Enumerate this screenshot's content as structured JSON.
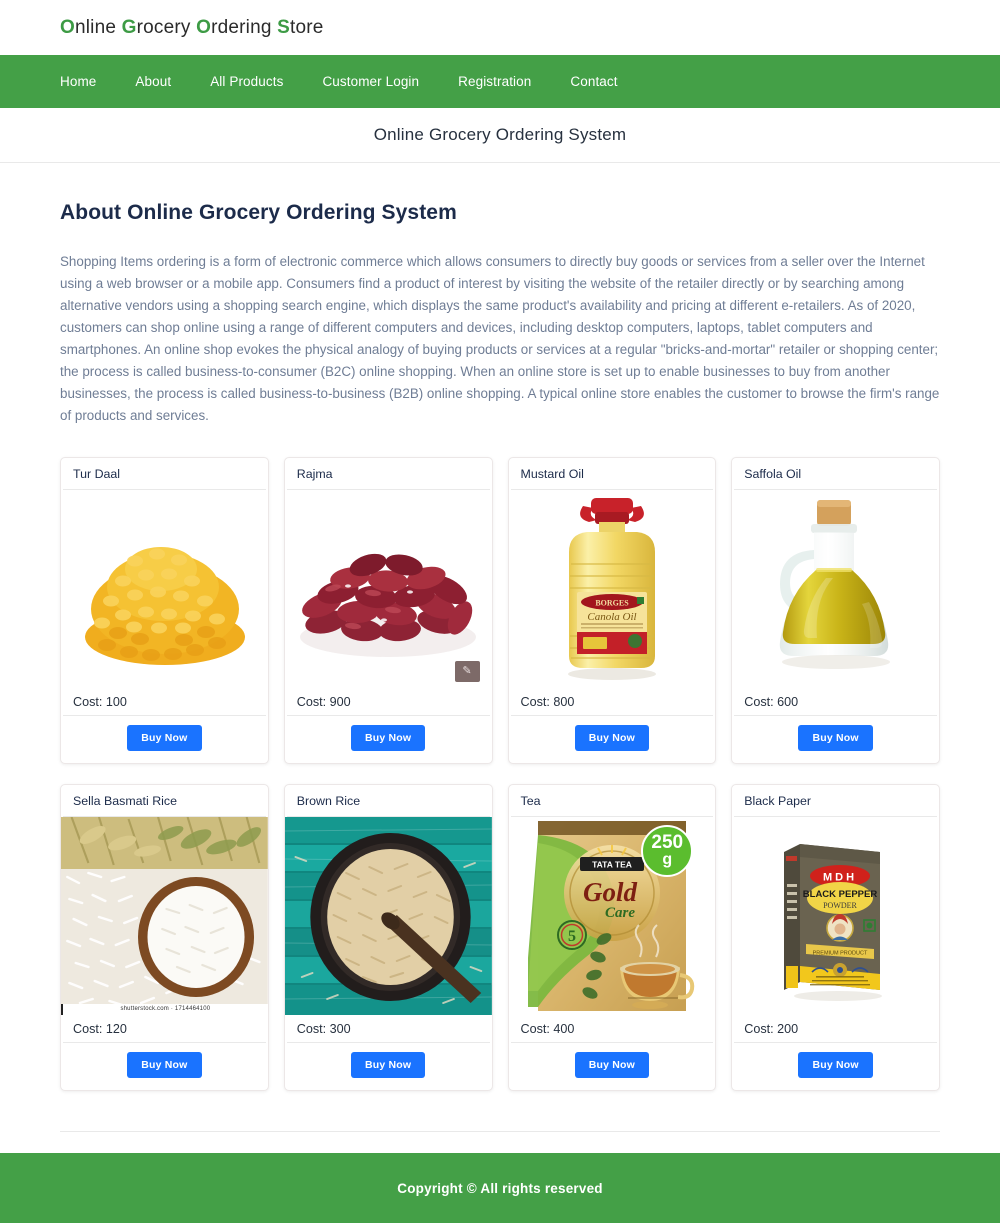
{
  "site": {
    "logo_parts": [
      {
        "cap": "O",
        "rest": "nline"
      },
      {
        "cap": "G",
        "rest": "rocery"
      },
      {
        "cap": "O",
        "rest": "rdering"
      },
      {
        "cap": "S",
        "rest": "tore"
      }
    ],
    "logo_full": "Online Grocery Ordering Store",
    "brand_green": "#44a047",
    "accent_blue": "#1a73ff"
  },
  "nav": {
    "items": [
      {
        "label": "Home"
      },
      {
        "label": "About"
      },
      {
        "label": "All Products"
      },
      {
        "label": "Customer Login"
      },
      {
        "label": "Registration"
      },
      {
        "label": "Contact"
      }
    ]
  },
  "page": {
    "title": "Online Grocery Ordering System",
    "about_heading": "About Online Grocery Ordering System",
    "about_body": "Shopping Items ordering is a form of electronic commerce which allows consumers to directly buy goods or services from a seller over the Internet using a web browser or a mobile app. Consumers find a product of interest by visiting the website of the retailer directly or by searching among alternative vendors using a shopping search engine, which displays the same product's availability and pricing at different e-retailers. As of 2020, customers can shop online using a range of different computers and devices, including desktop computers, laptops, tablet computers and smartphones. An online shop evokes the physical analogy of buying products or services at a regular \"bricks-and-mortar\" retailer or shopping center; the process is called business-to-consumer (B2C) online shopping. When an online store is set up to enable businesses to buy from another businesses, the process is called business-to-business (B2B) online shopping. A typical online store enables the customer to browse the firm's range of products and services."
  },
  "products": [
    {
      "name": "Tur Daal",
      "cost_label": "Cost: 100",
      "cost": 100,
      "buy_label": "Buy Now",
      "art": "tur-daal"
    },
    {
      "name": "Rajma",
      "cost_label": "Cost: 900",
      "cost": 900,
      "buy_label": "Buy Now",
      "art": "rajma",
      "watermark": "✎"
    },
    {
      "name": "Mustard Oil",
      "cost_label": "Cost: 800",
      "cost": 800,
      "buy_label": "Buy Now",
      "art": "mustard-oil",
      "pack_brand": "BORGES",
      "pack_title": "Canola Oil"
    },
    {
      "name": "Saffola Oil",
      "cost_label": "Cost: 600",
      "cost": 600,
      "buy_label": "Buy Now",
      "art": "saffola-oil"
    },
    {
      "name": "Sella Basmati Rice",
      "cost_label": "Cost: 120",
      "cost": 120,
      "buy_label": "Buy Now",
      "art": "sella-basmati-rice",
      "credit": "shutterstock.com · 1714464100"
    },
    {
      "name": "Brown Rice",
      "cost_label": "Cost: 300",
      "cost": 300,
      "buy_label": "Buy Now",
      "art": "brown-rice"
    },
    {
      "name": "Tea",
      "cost_label": "Cost: 400",
      "cost": 400,
      "buy_label": "Buy Now",
      "art": "tea",
      "badge_top": "250",
      "badge_bottom": "g",
      "pack_brand": "TATA TEA",
      "pack_title": "Gold Care"
    },
    {
      "name": "Black Paper",
      "cost_label": "Cost: 200",
      "cost": 200,
      "buy_label": "Buy Now",
      "art": "black-paper",
      "pack_brand": "MDH",
      "pack_title": "BLACK PEPPER",
      "pack_sub": "POWDER"
    }
  ],
  "footer": {
    "copyright": "Copyright © All rights reserved"
  }
}
